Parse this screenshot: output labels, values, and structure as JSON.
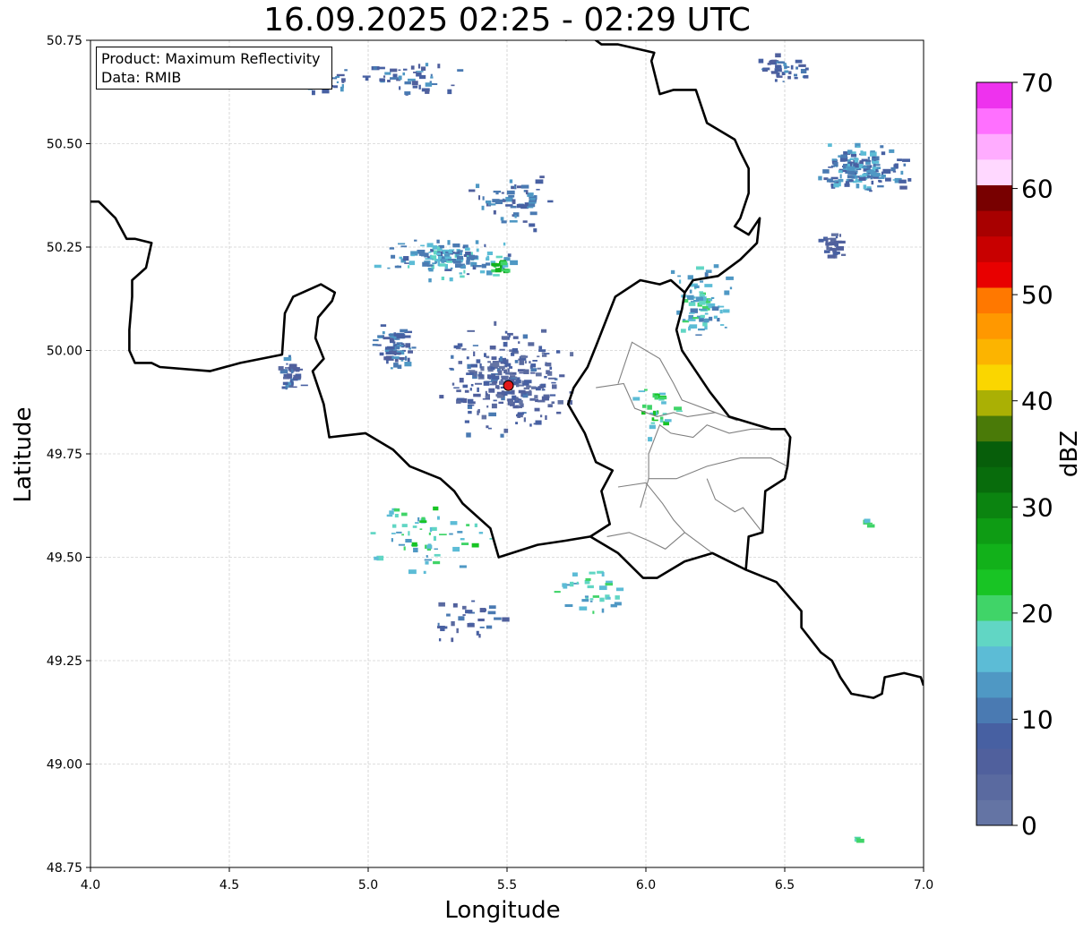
{
  "title": "16.09.2025 02:25 - 02:29 UTC",
  "info": {
    "product": "Product: Maximum Reflectivity",
    "data": "Data: RMIB"
  },
  "chart_data": {
    "type": "heatmap",
    "title": "16.09.2025 02:25 - 02:29 UTC",
    "xlabel": "Longitude",
    "ylabel": "Latitude",
    "xlim": [
      4.0,
      7.0
    ],
    "ylim": [
      48.75,
      50.75
    ],
    "x_ticks": [
      "4.0",
      "4.5",
      "5.0",
      "5.5",
      "6.0",
      "6.5",
      "7.0"
    ],
    "y_ticks": [
      "48.75",
      "49.00",
      "49.25",
      "49.50",
      "49.75",
      "50.00",
      "50.25",
      "50.50",
      "50.75"
    ],
    "grid": true,
    "radar_site": {
      "lon": 5.505,
      "lat": 49.915
    },
    "colorbar": {
      "label": "dBZ",
      "range": [
        0,
        70
      ],
      "ticks": [
        "0",
        "10",
        "20",
        "30",
        "40",
        "50",
        "60",
        "70"
      ],
      "step": 2.5,
      "colors": [
        "#6474a4",
        "#5a6aa0",
        "#50609d",
        "#4760a2",
        "#4a7ab2",
        "#4f98c4",
        "#5cbcd6",
        "#61d6c4",
        "#40d468",
        "#18c424",
        "#12b11a",
        "#0e9c14",
        "#0b8410",
        "#086c0c",
        "#075e0a",
        "#4a7a08",
        "#aab004",
        "#fad600",
        "#fcb400",
        "#ff9800",
        "#ff7800",
        "#e80000",
        "#c80000",
        "#a80000",
        "#780000",
        "#ffd8ff",
        "#ffacff",
        "#ff70ff",
        "#ee32ee"
      ]
    },
    "echoes": [
      {
        "lon": 5.3,
        "lat": 50.22,
        "dbz": 14,
        "spread_lon": 0.28,
        "spread_lat": 0.06,
        "count": 140
      },
      {
        "lon": 5.48,
        "lat": 50.2,
        "dbz": 24,
        "spread_lon": 0.06,
        "spread_lat": 0.02,
        "count": 16
      },
      {
        "lon": 5.55,
        "lat": 50.36,
        "dbz": 10,
        "spread_lon": 0.22,
        "spread_lat": 0.08,
        "count": 60
      },
      {
        "lon": 5.1,
        "lat": 50.0,
        "dbz": 10,
        "spread_lon": 0.09,
        "spread_lat": 0.07,
        "count": 70
      },
      {
        "lon": 4.72,
        "lat": 49.94,
        "dbz": 8,
        "spread_lon": 0.06,
        "spread_lat": 0.06,
        "count": 40
      },
      {
        "lon": 5.5,
        "lat": 49.93,
        "dbz": 6,
        "spread_lon": 0.28,
        "spread_lat": 0.16,
        "count": 260
      },
      {
        "lon": 6.78,
        "lat": 50.44,
        "dbz": 12,
        "spread_lon": 0.2,
        "spread_lat": 0.07,
        "count": 170
      },
      {
        "lon": 6.5,
        "lat": 50.68,
        "dbz": 10,
        "spread_lon": 0.14,
        "spread_lat": 0.04,
        "count": 40
      },
      {
        "lon": 6.68,
        "lat": 50.25,
        "dbz": 6,
        "spread_lon": 0.06,
        "spread_lat": 0.06,
        "count": 30
      },
      {
        "lon": 6.2,
        "lat": 50.1,
        "dbz": 16,
        "spread_lon": 0.14,
        "spread_lat": 0.12,
        "count": 80
      },
      {
        "lon": 4.85,
        "lat": 50.65,
        "dbz": 10,
        "spread_lon": 0.12,
        "spread_lat": 0.04,
        "count": 35
      },
      {
        "lon": 5.15,
        "lat": 50.66,
        "dbz": 10,
        "spread_lon": 0.22,
        "spread_lat": 0.06,
        "count": 45
      },
      {
        "lon": 6.05,
        "lat": 49.85,
        "dbz": 20,
        "spread_lon": 0.12,
        "spread_lat": 0.08,
        "count": 30
      },
      {
        "lon": 5.2,
        "lat": 49.55,
        "dbz": 18,
        "spread_lon": 0.3,
        "spread_lat": 0.12,
        "count": 60
      },
      {
        "lon": 5.8,
        "lat": 49.42,
        "dbz": 18,
        "spread_lon": 0.2,
        "spread_lat": 0.08,
        "count": 35
      },
      {
        "lon": 5.4,
        "lat": 49.35,
        "dbz": 8,
        "spread_lon": 0.22,
        "spread_lat": 0.08,
        "count": 30
      },
      {
        "lon": 6.8,
        "lat": 49.58,
        "dbz": 20,
        "spread_lon": 0.02,
        "spread_lat": 0.02,
        "count": 6
      },
      {
        "lon": 6.76,
        "lat": 48.82,
        "dbz": 20,
        "spread_lon": 0.02,
        "spread_lat": 0.01,
        "count": 5
      }
    ],
    "borders": {
      "country": [
        [
          [
            4.0,
            50.36
          ],
          [
            4.03,
            50.36
          ],
          [
            4.09,
            50.32
          ],
          [
            4.13,
            50.27
          ],
          [
            4.16,
            50.27
          ],
          [
            4.22,
            50.26
          ],
          [
            4.2,
            50.2
          ],
          [
            4.15,
            50.17
          ],
          [
            4.15,
            50.13
          ],
          [
            4.14,
            50.05
          ],
          [
            4.14,
            50.0
          ],
          [
            4.16,
            49.97
          ],
          [
            4.22,
            49.97
          ],
          [
            4.25,
            49.96
          ],
          [
            4.43,
            49.95
          ],
          [
            4.54,
            49.97
          ],
          [
            4.69,
            49.99
          ],
          [
            4.7,
            50.09
          ],
          [
            4.73,
            50.13
          ],
          [
            4.83,
            50.16
          ],
          [
            4.88,
            50.14
          ],
          [
            4.87,
            50.12
          ],
          [
            4.82,
            50.08
          ],
          [
            4.81,
            50.03
          ],
          [
            4.84,
            49.98
          ],
          [
            4.8,
            49.95
          ],
          [
            4.84,
            49.87
          ],
          [
            4.86,
            49.79
          ],
          [
            4.99,
            49.8
          ],
          [
            5.09,
            49.76
          ],
          [
            5.15,
            49.72
          ],
          [
            5.26,
            49.69
          ],
          [
            5.31,
            49.66
          ],
          [
            5.34,
            49.63
          ],
          [
            5.44,
            49.57
          ],
          [
            5.47,
            49.5
          ],
          [
            5.61,
            49.53
          ],
          [
            5.71,
            49.54
          ],
          [
            5.8,
            49.55
          ],
          [
            5.9,
            49.51
          ],
          [
            5.99,
            49.45
          ],
          [
            6.04,
            49.45
          ],
          [
            6.14,
            49.49
          ],
          [
            6.24,
            49.51
          ],
          [
            6.36,
            49.47
          ],
          [
            6.47,
            49.44
          ],
          [
            6.56,
            49.37
          ],
          [
            6.56,
            49.33
          ],
          [
            6.63,
            49.27
          ],
          [
            6.67,
            49.25
          ],
          [
            6.7,
            49.21
          ],
          [
            6.74,
            49.17
          ],
          [
            6.82,
            49.16
          ],
          [
            6.85,
            49.17
          ],
          [
            6.86,
            49.21
          ],
          [
            6.93,
            49.22
          ],
          [
            6.99,
            49.21
          ],
          [
            7.0,
            49.19
          ]
        ],
        [
          [
            5.71,
            50.75
          ],
          [
            5.78,
            50.78
          ],
          [
            5.8,
            50.76
          ],
          [
            5.84,
            50.74
          ],
          [
            5.9,
            50.74
          ],
          [
            6.03,
            50.72
          ],
          [
            6.02,
            50.7
          ],
          [
            6.05,
            50.62
          ],
          [
            6.1,
            50.63
          ],
          [
            6.18,
            50.63
          ],
          [
            6.22,
            50.55
          ],
          [
            6.32,
            50.51
          ],
          [
            6.34,
            50.48
          ],
          [
            6.37,
            50.44
          ],
          [
            6.37,
            50.38
          ],
          [
            6.34,
            50.32
          ],
          [
            6.32,
            50.3
          ],
          [
            6.37,
            50.28
          ],
          [
            6.41,
            50.32
          ],
          [
            6.4,
            50.26
          ],
          [
            6.34,
            50.22
          ],
          [
            6.26,
            50.18
          ],
          [
            6.17,
            50.17
          ],
          [
            6.14,
            50.14
          ],
          [
            6.09,
            50.17
          ],
          [
            6.05,
            50.16
          ],
          [
            5.98,
            50.17
          ],
          [
            5.89,
            50.13
          ],
          [
            5.82,
            50.01
          ],
          [
            5.79,
            49.96
          ],
          [
            5.74,
            49.91
          ],
          [
            5.72,
            49.87
          ],
          [
            5.78,
            49.8
          ],
          [
            5.82,
            49.73
          ],
          [
            5.88,
            49.71
          ],
          [
            5.84,
            49.66
          ],
          [
            5.87,
            49.58
          ],
          [
            5.8,
            49.55
          ]
        ],
        [
          [
            6.14,
            50.14
          ],
          [
            6.13,
            50.1
          ],
          [
            6.11,
            50.05
          ],
          [
            6.13,
            50.0
          ],
          [
            6.19,
            49.94
          ],
          [
            6.23,
            49.9
          ],
          [
            6.3,
            49.84
          ],
          [
            6.4,
            49.82
          ],
          [
            6.45,
            49.81
          ],
          [
            6.5,
            49.81
          ],
          [
            6.52,
            49.79
          ],
          [
            6.51,
            49.72
          ],
          [
            6.5,
            49.69
          ],
          [
            6.43,
            49.66
          ],
          [
            6.42,
            49.56
          ],
          [
            6.37,
            49.55
          ],
          [
            6.36,
            49.47
          ]
        ]
      ],
      "region": [
        [
          [
            5.9,
            49.92
          ],
          [
            5.95,
            50.02
          ],
          [
            6.05,
            49.98
          ],
          [
            6.1,
            49.92
          ],
          [
            6.13,
            49.88
          ],
          [
            6.25,
            49.85
          ],
          [
            6.33,
            49.83
          ]
        ],
        [
          [
            5.82,
            49.91
          ],
          [
            5.92,
            49.92
          ],
          [
            5.96,
            49.86
          ],
          [
            6.04,
            49.84
          ],
          [
            6.1,
            49.85
          ],
          [
            6.15,
            49.84
          ],
          [
            6.25,
            49.85
          ]
        ],
        [
          [
            5.98,
            49.62
          ],
          [
            6.01,
            49.69
          ],
          [
            6.01,
            49.75
          ],
          [
            6.05,
            49.82
          ],
          [
            6.09,
            49.8
          ],
          [
            6.17,
            49.79
          ],
          [
            6.22,
            49.82
          ],
          [
            6.3,
            49.8
          ],
          [
            6.38,
            49.81
          ],
          [
            6.45,
            49.81
          ]
        ],
        [
          [
            6.01,
            49.69
          ],
          [
            6.11,
            49.69
          ],
          [
            6.22,
            49.72
          ],
          [
            6.34,
            49.74
          ],
          [
            6.45,
            49.74
          ],
          [
            6.51,
            49.72
          ]
        ],
        [
          [
            5.9,
            49.67
          ],
          [
            6.0,
            49.68
          ],
          [
            6.06,
            49.63
          ],
          [
            6.1,
            49.59
          ],
          [
            6.14,
            49.56
          ],
          [
            6.22,
            49.52
          ],
          [
            6.24,
            49.51
          ]
        ],
        [
          [
            6.22,
            49.69
          ],
          [
            6.25,
            49.64
          ],
          [
            6.32,
            49.61
          ],
          [
            6.35,
            49.62
          ],
          [
            6.42,
            49.56
          ]
        ],
        [
          [
            5.86,
            49.55
          ],
          [
            5.94,
            49.56
          ],
          [
            6.01,
            49.54
          ],
          [
            6.07,
            49.52
          ],
          [
            6.14,
            49.56
          ]
        ]
      ]
    }
  }
}
